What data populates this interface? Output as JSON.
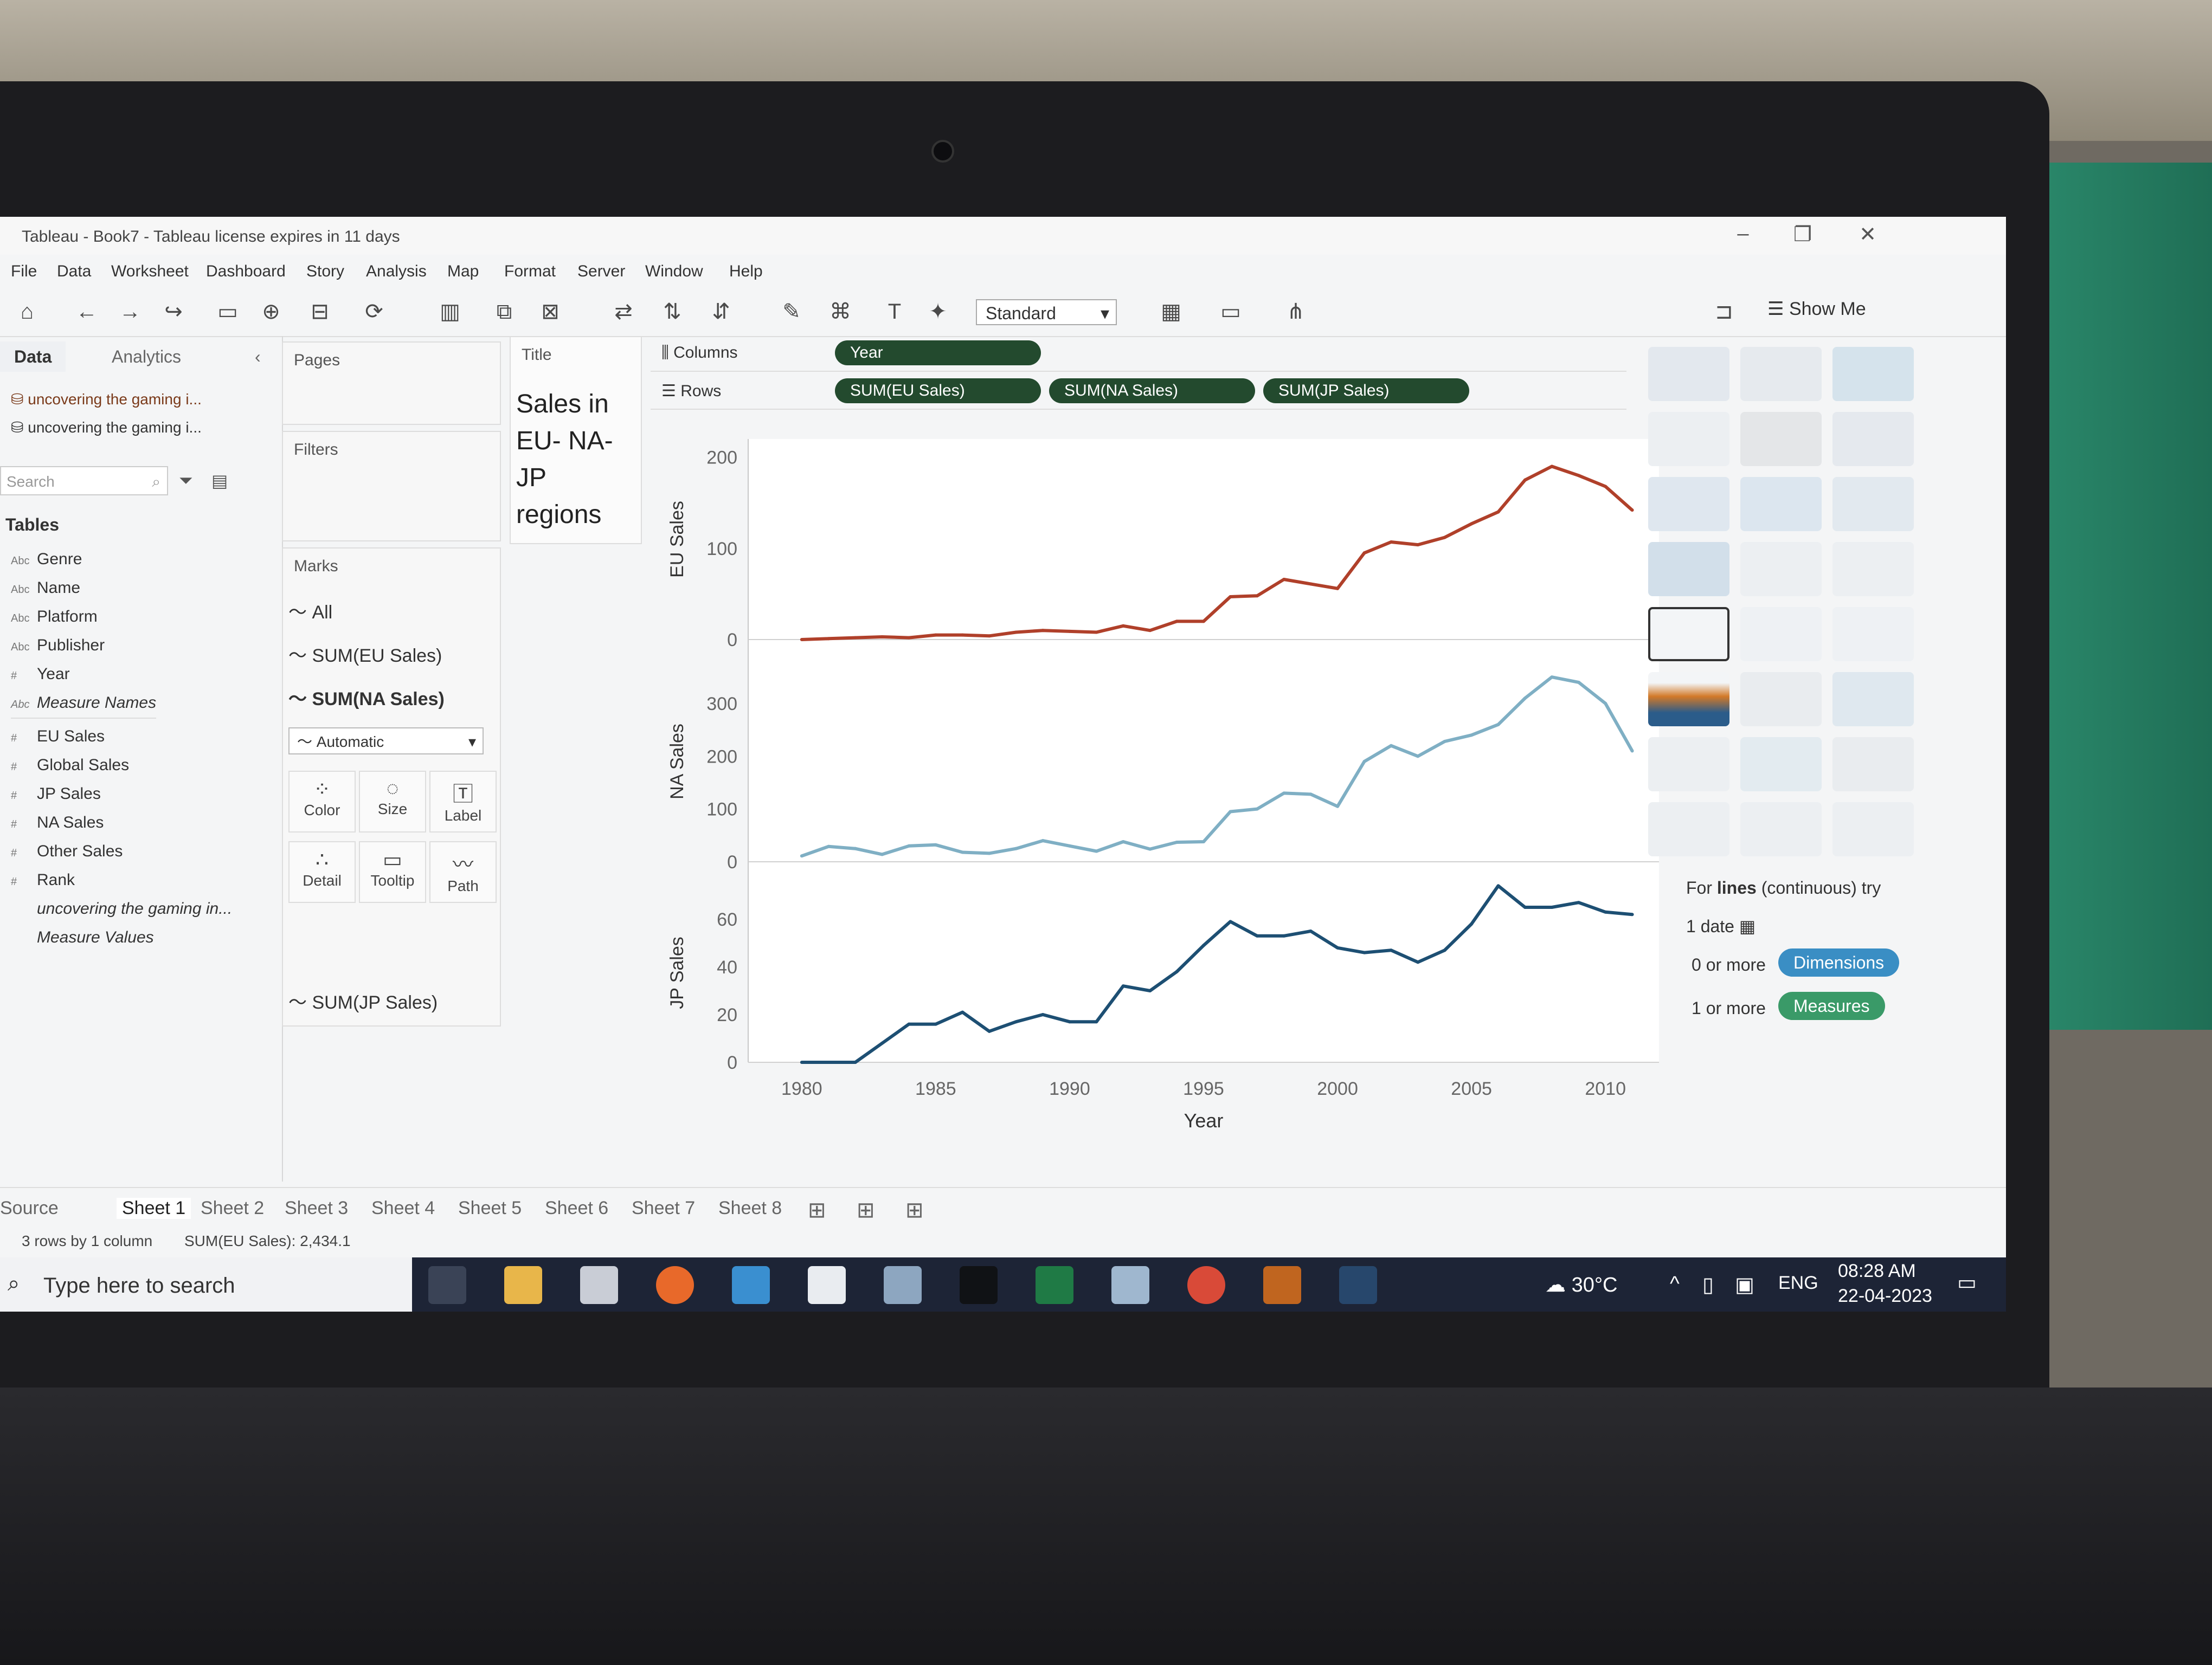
{
  "window": {
    "title": "Tableau - Book7 - Tableau license expires in 11 days"
  },
  "menu": [
    "File",
    "Data",
    "Worksheet",
    "Dashboard",
    "Story",
    "Analysis",
    "Map",
    "Format",
    "Server",
    "Window",
    "Help"
  ],
  "toolbar": {
    "fit_select": "Standard",
    "show_me": "Show Me"
  },
  "data_pane": {
    "tabs": [
      "Data",
      "Analytics"
    ],
    "sources": [
      "uncovering the gaming i...",
      "uncovering the gaming i..."
    ],
    "search_placeholder": "Search",
    "tables_heading": "Tables",
    "fields": [
      {
        "type": "Abc",
        "name": "Genre"
      },
      {
        "type": "Abc",
        "name": "Name"
      },
      {
        "type": "Abc",
        "name": "Platform"
      },
      {
        "type": "Abc",
        "name": "Publisher"
      },
      {
        "type": "#",
        "name": "Year"
      },
      {
        "type": "Abc",
        "name": "Measure Names"
      },
      {
        "type": "#",
        "name": "EU Sales"
      },
      {
        "type": "#",
        "name": "Global Sales"
      },
      {
        "type": "#",
        "name": "JP Sales"
      },
      {
        "type": "#",
        "name": "NA Sales"
      },
      {
        "type": "#",
        "name": "Other Sales"
      },
      {
        "type": "#",
        "name": "Rank"
      },
      {
        "type": "",
        "name": "uncovering the gaming in..."
      },
      {
        "type": "",
        "name": "Measure Values"
      }
    ]
  },
  "cards": {
    "pages": "Pages",
    "filters": "Filters",
    "marks": "Marks",
    "marks_rows": [
      "All",
      "SUM(EU Sales)",
      "SUM(NA Sales)"
    ],
    "mark_type": "Automatic",
    "mark_buttons": [
      "Color",
      "Size",
      "Label",
      "Detail",
      "Tooltip",
      "Path"
    ],
    "last_mark": "SUM(JP Sales)"
  },
  "title_card": {
    "label": "Title",
    "text": "Sales in EU- NA- JP regions"
  },
  "shelves": {
    "columns_label": "Columns",
    "rows_label": "Rows",
    "columns": [
      "Year"
    ],
    "rows": [
      "SUM(EU Sales)",
      "SUM(NA Sales)",
      "SUM(JP Sales)"
    ]
  },
  "chart_data": {
    "type": "line",
    "xlabel": "Year",
    "x_ticks": [
      1980,
      1985,
      1990,
      1995,
      2000,
      2005,
      2010
    ],
    "x": [
      1980,
      1981,
      1982,
      1983,
      1984,
      1985,
      1986,
      1987,
      1988,
      1989,
      1990,
      1991,
      1992,
      1993,
      1994,
      1995,
      1996,
      1997,
      1998,
      1999,
      2000,
      2001,
      2002,
      2003,
      2004,
      2005,
      2006,
      2007,
      2008,
      2009,
      2010,
      2011
    ],
    "series": [
      {
        "name": "EU Sales",
        "ylabel": "EU Sales",
        "ylim": [
          0,
          220
        ],
        "yticks": [
          0,
          100,
          200
        ],
        "color": "#b0402a",
        "values": [
          0,
          1,
          2,
          3,
          2,
          5,
          5,
          4,
          8,
          10,
          9,
          8,
          15,
          10,
          20,
          20,
          47,
          48,
          66,
          61,
          56,
          95,
          107,
          104,
          112,
          127,
          140,
          175,
          190,
          180,
          168,
          142
        ]
      },
      {
        "name": "NA Sales",
        "ylabel": "NA Sales",
        "ylim": [
          0,
          380
        ],
        "yticks": [
          0,
          100,
          200,
          300
        ],
        "color": "#7fafc4",
        "values": [
          11,
          29,
          25,
          14,
          30,
          32,
          18,
          16,
          25,
          40,
          30,
          20,
          38,
          24,
          37,
          38,
          95,
          100,
          130,
          128,
          105,
          190,
          220,
          200,
          228,
          240,
          260,
          310,
          350,
          340,
          300,
          210
        ]
      },
      {
        "name": "JP Sales",
        "ylabel": "JP Sales",
        "ylim": [
          0,
          75
        ],
        "yticks": [
          0,
          20,
          40,
          60
        ],
        "color": "#1d4f73",
        "values": [
          0,
          0,
          0,
          8,
          16,
          16,
          21,
          13,
          17,
          20,
          17,
          17,
          32,
          30,
          38,
          49,
          59,
          53,
          53,
          55,
          48,
          46,
          47,
          42,
          47,
          58,
          74,
          65,
          65,
          67,
          63,
          62
        ]
      }
    ]
  },
  "show_me": {
    "hint_prefix": "For",
    "hint_bold": "lines",
    "hint_suffix": "(continuous) try",
    "req_date": "1 date",
    "req_dims_prefix": "0 or more",
    "req_dims": "Dimensions",
    "req_measures_prefix": "1 or more",
    "req_measures": "Measures",
    "colors": {
      "dimensions": "#3a8ec4",
      "measures": "#3a9a68"
    }
  },
  "sheets": [
    "Source",
    "Sheet 1",
    "Sheet 2",
    "Sheet 3",
    "Sheet 4",
    "Sheet 5",
    "Sheet 6",
    "Sheet 7",
    "Sheet 8"
  ],
  "status": {
    "rows_info": "3 rows by 1 column",
    "sum_info": "SUM(EU Sales): 2,434.1"
  },
  "taskbar": {
    "search_placeholder": "Type here to search",
    "weather": "30°C",
    "language": "ENG",
    "time": "08:28 AM",
    "date": "22-04-2023"
  }
}
